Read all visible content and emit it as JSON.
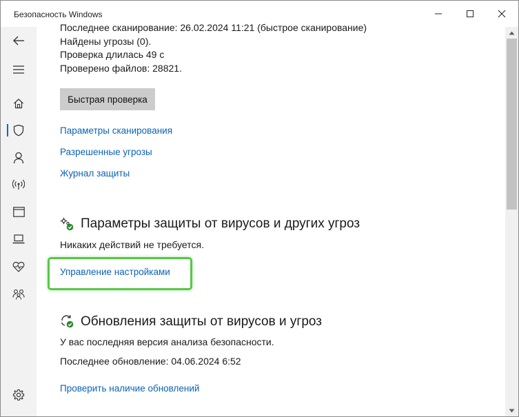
{
  "window": {
    "title": "Безопасность Windows",
    "minimize_glyph": "—",
    "maximize_glyph": "☐",
    "close_glyph": "✕"
  },
  "scan_summary": {
    "last_scan": "Последнее сканирование: 26.02.2024 11:21 (быстрое сканирование)",
    "threats_found": "Найдены угрозы (0).",
    "scan_duration": "Проверка длилась 49 с",
    "files_checked": "Проверено файлов: 28821."
  },
  "quick_scan_button": "Быстрая проверка",
  "links": {
    "scan_options": "Параметры сканирования",
    "allowed_threats": "Разрешенные угрозы",
    "protection_history": "Журнал защиты"
  },
  "virus_protection_settings": {
    "title": "Параметры защиты от вирусов и других угроз",
    "status": "Никаких действий не требуется.",
    "manage_link": "Управление настройками"
  },
  "virus_protection_updates": {
    "title": "Обновления защиты от вирусов и угроз",
    "status": "У вас последняя версия анализа безопасности.",
    "last_update": "Последнее обновление: 04.06.2024 6:52",
    "check_link": "Проверить наличие обновлений"
  },
  "colors": {
    "link": "#0b62b5",
    "accent": "#0067c0",
    "highlight": "#58c747",
    "ok_badge": "#2c8a2c"
  }
}
